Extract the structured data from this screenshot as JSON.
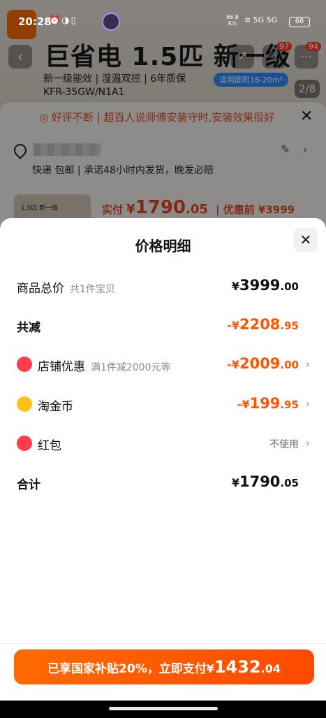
{
  "status_bar": {
    "time": "20:28",
    "net_speed_value": "86.8",
    "net_speed_unit": "K/s",
    "network": "5G 5G",
    "battery": "66"
  },
  "background": {
    "product_title": "巨省电 1.5匹 新一级",
    "features": "新一级能效 | 湿温双控 | 6年质保",
    "model": "KFR-35GW/N1A1",
    "area_tag": "适用面积16-20m²",
    "cart_badge": "97",
    "more_badge": "94",
    "image_counter": "2/8",
    "banner_text": "好评不断 | 超百人说师傅安装守时,安装效果很好",
    "shipping_text": "快递 包邮 | 承诺48小时内发货，晚发必赔",
    "thumb_text": "1.5匹 新一级",
    "pay_label": "实付",
    "pay_currency": "¥",
    "pay_int": "1790",
    "pay_dec": ".05",
    "pay_before": "| 优惠前 ¥3999"
  },
  "sheet": {
    "title": "价格明细",
    "rows": {
      "total": {
        "label": "商品总价",
        "hint": "共1件宝贝",
        "currency": "¥",
        "int": "3999",
        "dec": ".00"
      },
      "reduce": {
        "label": "共减",
        "currency": "-¥",
        "int": "2208",
        "dec": ".95"
      },
      "shop": {
        "label": "店铺优惠",
        "hint": "满1件减2000元等",
        "currency": "-¥",
        "int": "2009",
        "dec": ".00"
      },
      "coins": {
        "label": "淘金币",
        "currency": "-¥",
        "int": "199",
        "dec": ".95"
      },
      "redpack": {
        "label": "红包",
        "value": "不使用"
      },
      "sum": {
        "label": "合计",
        "currency": "¥",
        "int": "1790",
        "dec": ".05"
      }
    }
  },
  "pay_button": {
    "text": "已享国家补贴20%，立即支付",
    "currency": "¥",
    "int": "1432",
    "dec": ".04"
  },
  "colors": {
    "accent": "#ff5500",
    "button": "#ff6a00"
  }
}
